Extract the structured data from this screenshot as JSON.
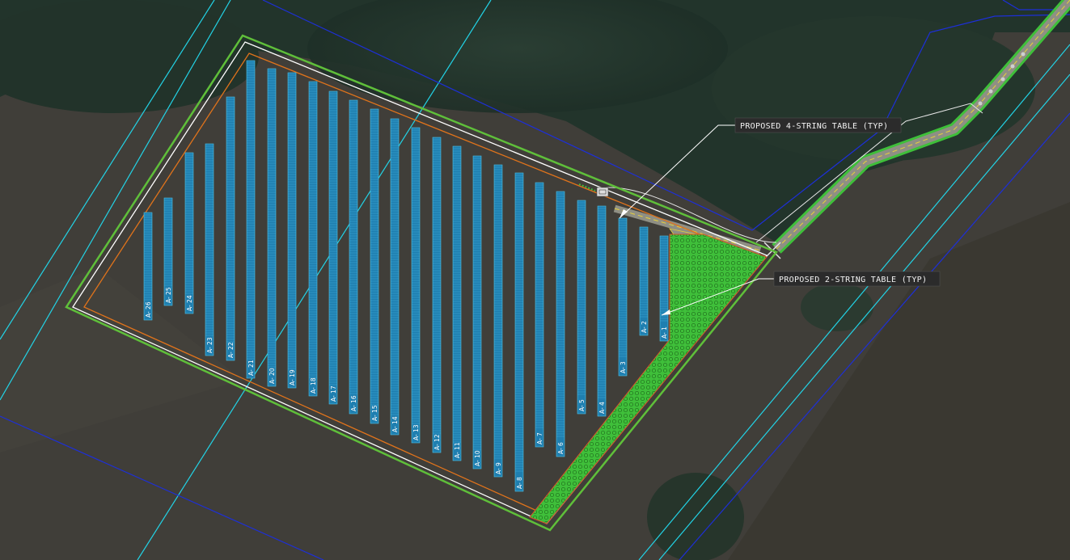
{
  "callouts": [
    {
      "id": "four-string",
      "text": "PROPOSED 4-STRING TABLE (TYP)"
    },
    {
      "id": "two-string",
      "text": "PROPOSED 2-STRING TABLE (TYP)"
    }
  ],
  "rows": [
    {
      "id": "A-1",
      "label": "A- 1"
    },
    {
      "id": "A-2",
      "label": "A- 2"
    },
    {
      "id": "A-3",
      "label": "A- 3"
    },
    {
      "id": "A-4",
      "label": "A- 4"
    },
    {
      "id": "A-5",
      "label": "A- 5"
    },
    {
      "id": "A-6",
      "label": "A- 6"
    },
    {
      "id": "A-7",
      "label": "A- 7"
    },
    {
      "id": "A-8",
      "label": "A- 8"
    },
    {
      "id": "A-9",
      "label": "A- 9"
    },
    {
      "id": "A-10",
      "label": "A- 10"
    },
    {
      "id": "A-11",
      "label": "A- 11"
    },
    {
      "id": "A-12",
      "label": "A- 12"
    },
    {
      "id": "A-13",
      "label": "A- 13"
    },
    {
      "id": "A-14",
      "label": "A- 14"
    },
    {
      "id": "A-15",
      "label": "A- 15"
    },
    {
      "id": "A-16",
      "label": "A- 16"
    },
    {
      "id": "A-17",
      "label": "A- 17"
    },
    {
      "id": "A-18",
      "label": "A- 18"
    },
    {
      "id": "A-19",
      "label": "A- 19"
    },
    {
      "id": "A-20",
      "label": "A- 20"
    },
    {
      "id": "A-21",
      "label": "A- 21"
    },
    {
      "id": "A-22",
      "label": "A- 22"
    },
    {
      "id": "A-23",
      "label": "A- 23"
    },
    {
      "id": "A-24",
      "label": "A- 24"
    },
    {
      "id": "A-25",
      "label": "A- 25"
    },
    {
      "id": "A-26",
      "label": "A- 26"
    }
  ],
  "colors": {
    "panel": "#1f7fb0",
    "panel_grid": "#4fc3ea",
    "fence": "#ffffff",
    "setback": "#e0731b",
    "property": "#5fbf3a",
    "parcel_cyan": "#22d3e6",
    "parcel_blue": "#1d2fd8",
    "vegetation": "#3fbf3a",
    "road": "#8f8f84",
    "road_center": "#e8d23a"
  }
}
